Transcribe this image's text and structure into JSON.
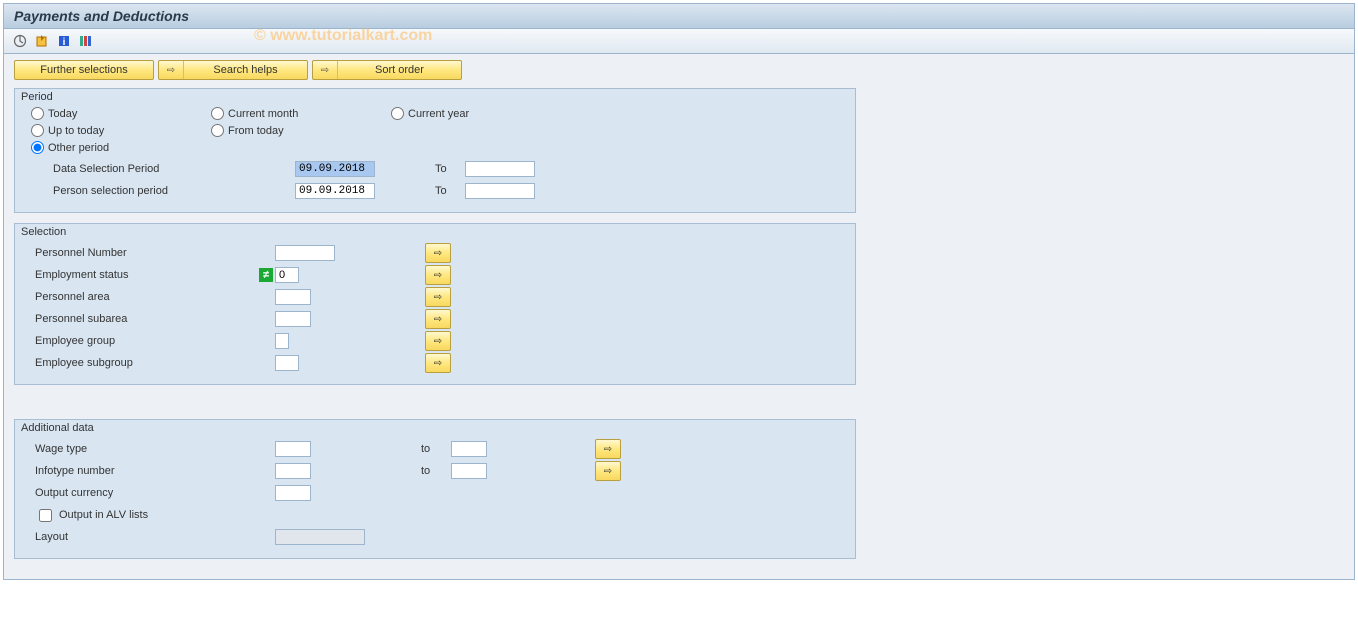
{
  "title": "Payments and Deductions",
  "watermark": "© www.tutorialkart.com",
  "sub_toolbar": {
    "further_selections": "Further selections",
    "search_helps": "Search helps",
    "sort_order": "Sort order"
  },
  "period": {
    "group_title": "Period",
    "today": "Today",
    "current_month": "Current month",
    "current_year": "Current year",
    "up_to_today": "Up to today",
    "from_today": "From today",
    "other_period": "Other period",
    "other_selected": true,
    "data_sel_label": "Data Selection Period",
    "data_sel_from": "09.09.2018",
    "data_sel_to_label": "To",
    "data_sel_to": "",
    "person_sel_label": "Person selection period",
    "person_sel_from": "09.09.2018",
    "person_sel_to_label": "To",
    "person_sel_to": ""
  },
  "selection": {
    "group_title": "Selection",
    "personnel_number": {
      "label": "Personnel Number",
      "value": ""
    },
    "employment_status": {
      "label": "Employment status",
      "value": "0"
    },
    "personnel_area": {
      "label": "Personnel area",
      "value": ""
    },
    "personnel_subarea": {
      "label": "Personnel subarea",
      "value": ""
    },
    "employee_group": {
      "label": "Employee group",
      "value": ""
    },
    "employee_subgroup": {
      "label": "Employee subgroup",
      "value": ""
    }
  },
  "additional": {
    "group_title": "Additional data",
    "wage_type": {
      "label": "Wage type",
      "from": "",
      "to_label": "to",
      "to": ""
    },
    "infotype_number": {
      "label": "Infotype number",
      "from": "",
      "to_label": "to",
      "to": ""
    },
    "output_currency": {
      "label": "Output currency",
      "value": ""
    },
    "alv_checkbox": {
      "label": "Output in ALV lists",
      "checked": false
    },
    "layout": {
      "label": "Layout",
      "value": ""
    }
  }
}
